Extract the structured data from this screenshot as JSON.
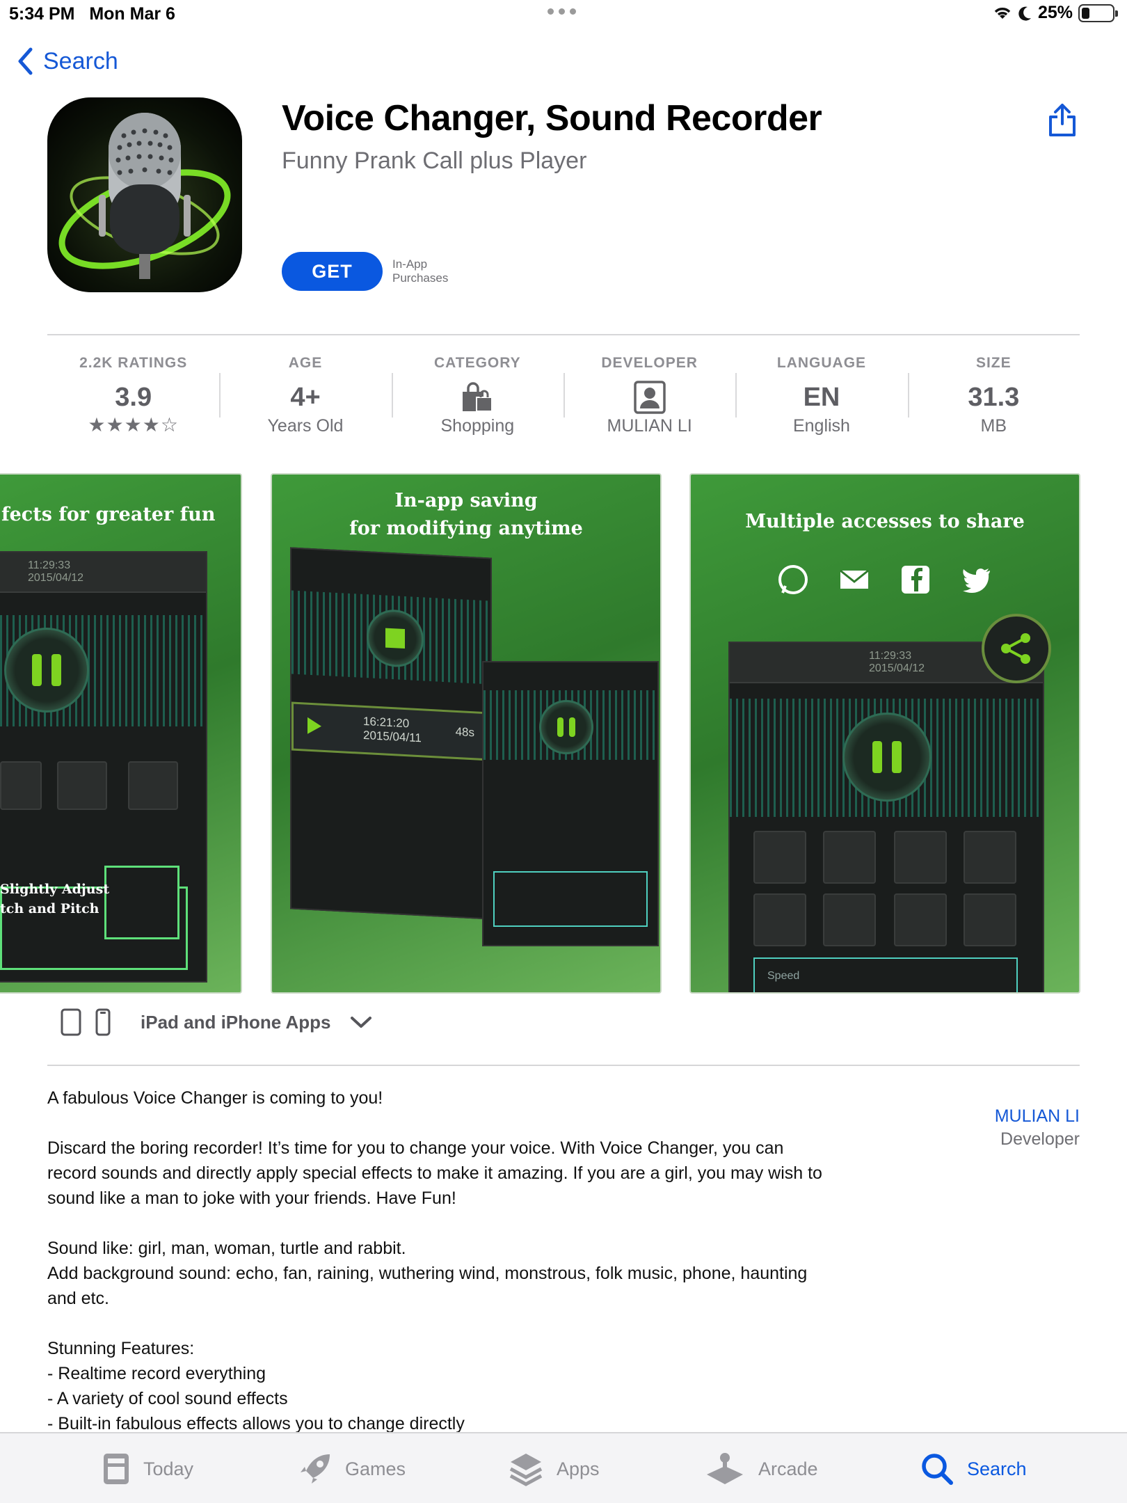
{
  "status_bar": {
    "time": "5:34 PM",
    "date": "Mon Mar 6",
    "battery": "25%"
  },
  "nav": {
    "back_label": "Search"
  },
  "app": {
    "title": "Voice Changer, Sound Recorder",
    "subtitle": "Funny Prank Call plus Player",
    "get_label": "GET",
    "iap_line1": "In-App",
    "iap_line2": "Purchases"
  },
  "info_strip": {
    "ratings": {
      "label": "2.2K RATINGS",
      "value": "3.9",
      "stars": "★★★★☆"
    },
    "age": {
      "label": "AGE",
      "value": "4+",
      "sub": "Years Old"
    },
    "category": {
      "label": "CATEGORY",
      "sub": "Shopping"
    },
    "developer": {
      "label": "DEVELOPER",
      "sub": "MULIAN LI"
    },
    "language": {
      "label": "LANGUAGE",
      "value": "EN",
      "sub": "English"
    },
    "size": {
      "label": "SIZE",
      "value": "31.3",
      "sub": "MB"
    }
  },
  "screenshots": [
    {
      "caption": "fects for greater fun",
      "time": "11:29:33",
      "date": "2015/04/12",
      "note1": "Slightly Adjust",
      "note2": "tch and Pitch"
    },
    {
      "caption1": "In-app saving",
      "caption2": "for modifying anytime",
      "row_time": "16:21:20",
      "row_date": "2015/04/11",
      "row_dur": "48s"
    },
    {
      "caption": "Multiple accesses to share",
      "time": "11:29:33",
      "date": "2015/04/12",
      "speed": "Speed"
    }
  ],
  "device_row": {
    "label": "iPad and iPhone Apps"
  },
  "description": {
    "p1": "A fabulous Voice Changer is coming to you!",
    "p2": "Discard the boring recorder! It’s time for you to change your voice. With Voice Changer, you can record sounds and directly apply special effects to make it amazing. If you are a girl, you may wish to sound like a man to joke with your friends. Have Fun!",
    "p3a": "Sound like: girl, man, woman, turtle and rabbit.",
    "p3b": "Add background sound: echo, fan, raining, wuthering wind, monstrous, folk music, phone, haunting and etc.",
    "p4": "Stunning Features:",
    "f1": "- Realtime record everything",
    "f2": "- A variety of cool sound effects",
    "f3": "- Built-in fabulous effects allows you to change directly"
  },
  "developer_link": {
    "name": "MULIAN LI",
    "role": "Developer"
  },
  "tabbar": {
    "today": "Today",
    "games": "Games",
    "apps": "Apps",
    "arcade": "Arcade",
    "search": "Search"
  },
  "colors": {
    "accent": "#0a58e0",
    "link": "#1558d6",
    "screenshot_green": "#3f9a3a",
    "neon": "#7ed321"
  }
}
